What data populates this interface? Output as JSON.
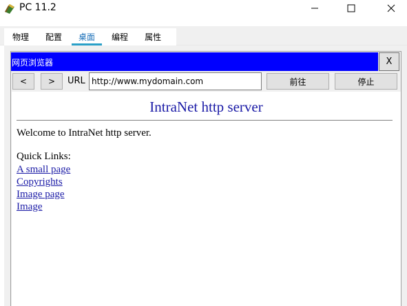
{
  "window": {
    "title": "PC 11.2",
    "icons": {
      "app": "pc-app-icon",
      "minimize": "minimize-icon",
      "maximize": "maximize-icon",
      "close": "close-icon"
    }
  },
  "tabs": [
    {
      "label": "物理",
      "active": false
    },
    {
      "label": "配置",
      "active": false
    },
    {
      "label": "桌面",
      "active": true
    },
    {
      "label": "编程",
      "active": false
    },
    {
      "label": "属性",
      "active": false
    }
  ],
  "browser": {
    "title": "网页浏览器",
    "close_label": "X",
    "back_label": "<",
    "forward_label": ">",
    "url_label": "URL",
    "url_value": "http://www.mydomain.com",
    "go_label": "前往",
    "stop_label": "停止",
    "title_bar_color": "#0000ff"
  },
  "page": {
    "heading": "IntraNet http server",
    "welcome": "Welcome to IntraNet http server.",
    "quick_links_label": "Quick Links:",
    "links": [
      "A small page",
      "Copyrights",
      "Image page",
      "Image"
    ],
    "link_color": "#1a1aa6"
  }
}
